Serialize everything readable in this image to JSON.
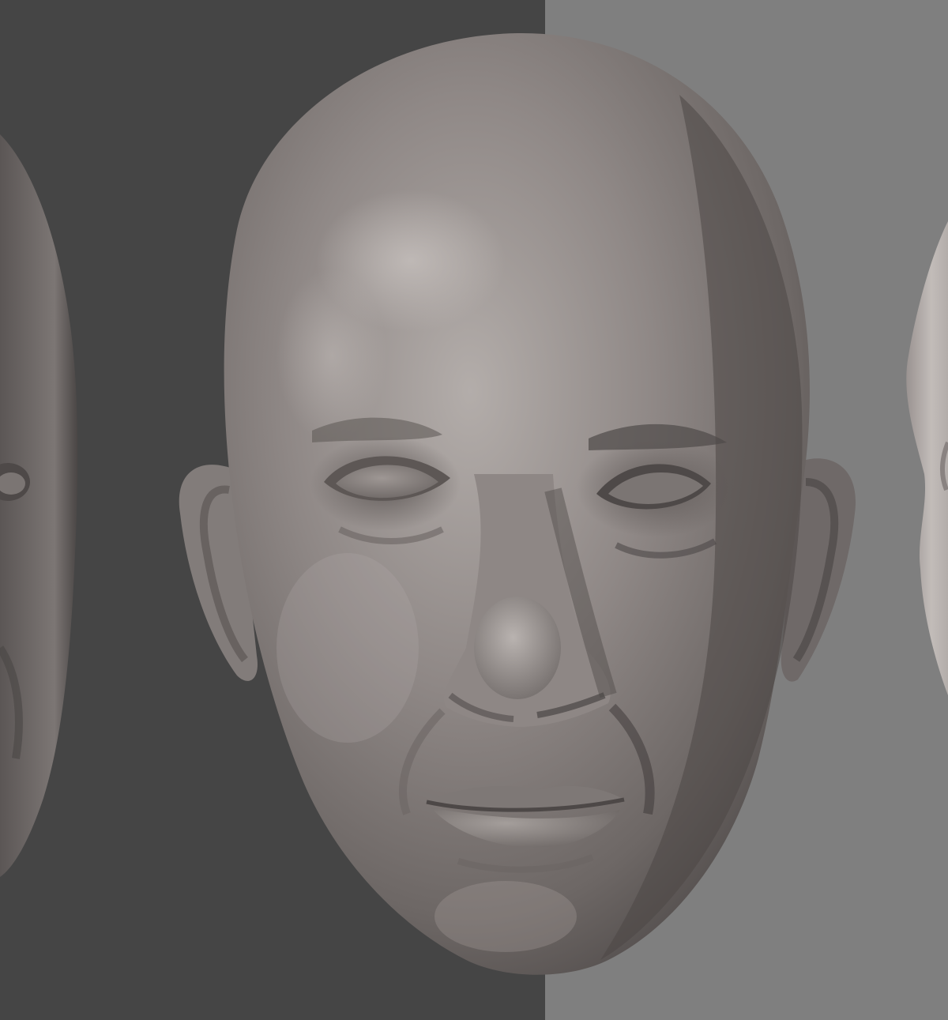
{
  "scene": {
    "colors": {
      "backdrop_dark": "#454545",
      "backdrop_light": "#7f7f7f",
      "clay_base": "#8a8381",
      "clay_highlight": "#bcb6b3",
      "clay_shadow": "#4f4a49"
    },
    "objects": [
      {
        "name": "center-head",
        "description_icon": "sculpted-head-front"
      },
      {
        "name": "left-head-partial",
        "description_icon": "sculpted-head-three-quarter"
      },
      {
        "name": "right-head-partial",
        "description_icon": "sculpted-head-profile"
      }
    ]
  }
}
